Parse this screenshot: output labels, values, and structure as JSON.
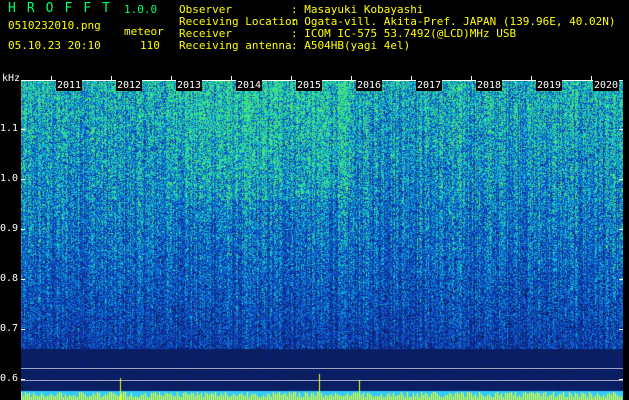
{
  "header": {
    "logo": "HROFFT",
    "version": "1.0.0",
    "filename": "0510232010.png",
    "mode": "meteor",
    "datetime": "05.10.23 20:10",
    "count": "110"
  },
  "info": {
    "labels": [
      "Observer",
      "Receiving Location",
      "Receiver",
      "Receiving antenna"
    ],
    "values": [
      ": Masayuki Kobayashi",
      ": Ogata-vill. Akita-Pref. JAPAN (139.96E, 40.02N)",
      ": ICOM IC-575 53.7492(@LCD)MHz USB",
      ": A504HB(yagi 4el)"
    ]
  },
  "axis": {
    "unit": "kHz",
    "y_ticks": [
      "1.1",
      "1.0",
      "0.9",
      "0.8",
      "0.7",
      "0.6"
    ],
    "years": [
      "2011",
      "2012",
      "2013",
      "2014",
      "2015",
      "2016",
      "2017",
      "2018",
      "2019",
      "2020"
    ]
  },
  "colors": {
    "background": "#000000",
    "text": "#ffff00",
    "logo": "#00ff66",
    "spectrum_base": "#0c2a8a",
    "baseline_bar": "#33ccff",
    "meteor_spike": "#ffff00"
  }
}
